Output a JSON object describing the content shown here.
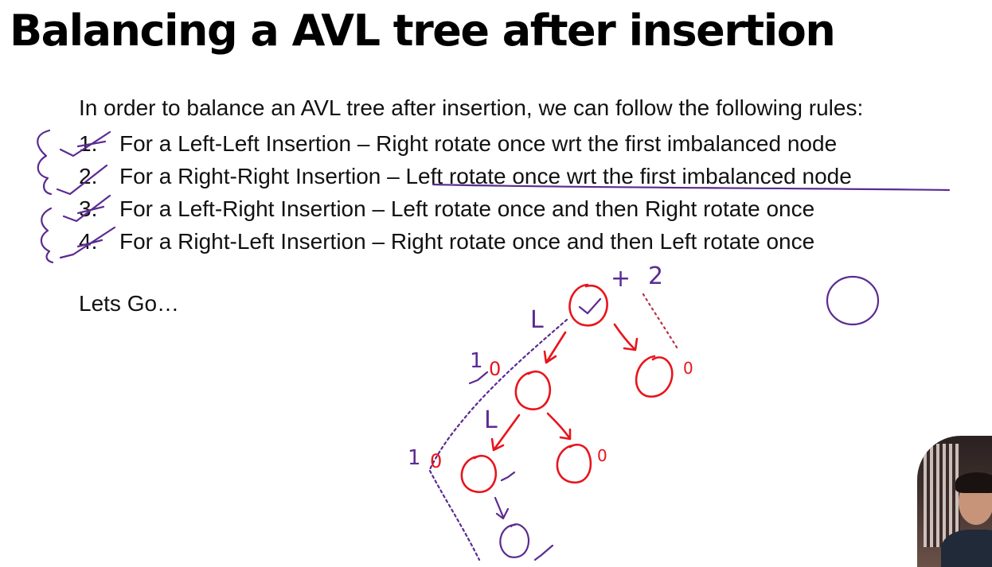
{
  "title": "Balancing a AVL tree after insertion",
  "intro": "In order to balance an AVL tree after insertion, we can follow the following rules:",
  "rules": [
    {
      "num": "1.",
      "text": "For a Left-Left Insertion – Right rotate once wrt the first imbalanced node"
    },
    {
      "num": "2.",
      "text": "For a Right-Right Insertion – Left rotate once wrt the first imbalanced node"
    },
    {
      "num": "3.",
      "text": "For a Left-Right Insertion – Left rotate once and then Right rotate once"
    },
    {
      "num": "4.",
      "text": "For a Right-Left Insertion – Right rotate once and then Left rotate once"
    }
  ],
  "lets_go": "Lets Go…",
  "annotations": {
    "root_balance": "2",
    "root_mark": "+",
    "left_child_balance": "1",
    "left_child_zero": "0",
    "right_child_balance": "0",
    "left_grandchild_balance": "1",
    "left_grandchild_zero": "0",
    "right_grandchild_balance": "0",
    "edge_label_top": "L",
    "edge_label_mid": "L"
  },
  "colors": {
    "text": "#111111",
    "red_ink": "#e8141c",
    "purple_ink": "#5b2b91"
  }
}
